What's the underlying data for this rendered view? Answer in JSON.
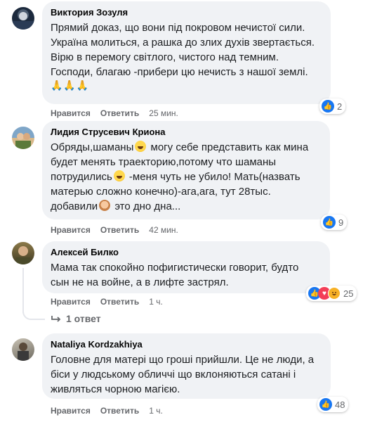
{
  "actions": {
    "like": "Нравится",
    "reply": "Ответить"
  },
  "comments": [
    {
      "author": "Виктория Зозуля",
      "text": "Прямий доказ, що вони під покровом нечистої сили.\nУкраїна молиться, а рашка до злих духів звертається.\nВірю в перемогу світлого, чистого над темним.\nГосподи, благаю -прибери цю нечисть з нашої землі.",
      "emoji_line": "🙏🙏🙏",
      "time": "25 мин.",
      "reactions_count": "2",
      "reaction_icons": [
        "like-icon"
      ]
    },
    {
      "author": "Лидия Струсевич Криона",
      "text_a": "Обряды,шаманы",
      "text_b": " могу себе представить как мина\nбудет менять траекторию,потому что шаманы\nпотрудились",
      "text_c": " -меня чуть не убило! Мать(назвать\nматерью сложно конечно)-ага,ага, тут 28тыс.\nдобавили",
      "text_d": " это дно дна...",
      "time": "42 мин.",
      "reactions_count": "9",
      "reaction_icons": [
        "like-icon"
      ]
    },
    {
      "author": "Алексей Билко",
      "text": "Мама так спокойно пофигистически говорит, будто\nсын не на войне, а в лифте застрял.",
      "time": "1 ч.",
      "reactions_count": "25",
      "reaction_icons": [
        "like-icon",
        "heart-icon",
        "laugh-icon"
      ],
      "replies_label": "1 ответ"
    },
    {
      "author": "Nataliya Kordzakhiya",
      "text": "Головне для матері що гроші прийшли. Це не люди, а\nбіси у людському обличчі що вклоняються сатані і\nживляться чорною магією.",
      "time": "1 ч.",
      "reactions_count": "48",
      "reaction_icons": [
        "like-icon"
      ]
    }
  ],
  "colors": {
    "like": "#1877f2",
    "heart": "#f33e58",
    "haha": "#f7b125",
    "bubble": "#f0f2f5",
    "meta": "#65676b"
  }
}
